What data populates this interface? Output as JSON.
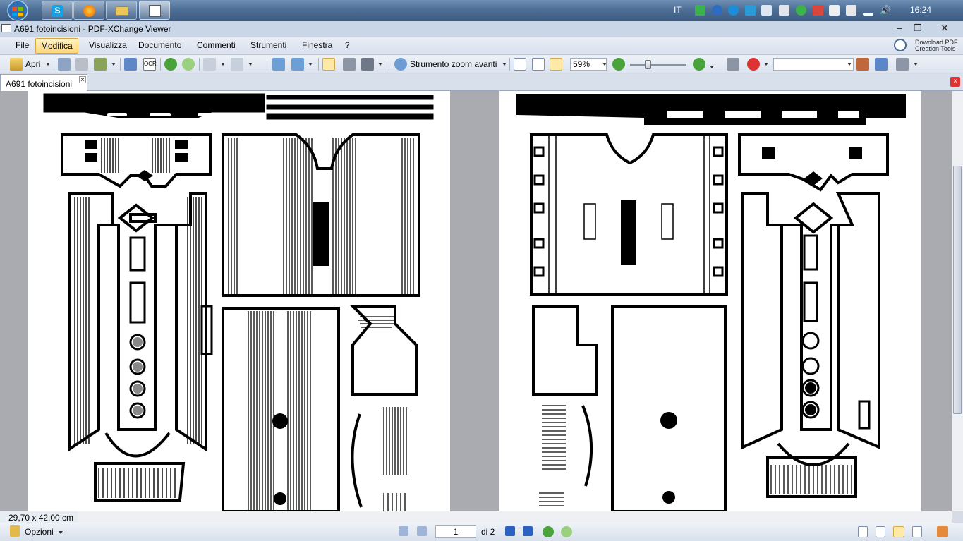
{
  "taskbar": {
    "language": "IT",
    "clock": "16:24",
    "pinned": [
      "skype-icon",
      "firefox-icon",
      "explorer-icon",
      "pdf-viewer-icon"
    ]
  },
  "window": {
    "title": "A691 fotoincisioni - PDF-XChange Viewer"
  },
  "menu": {
    "file": "File",
    "modifica": "Modifica",
    "visualizza": "Visualizza",
    "documento": "Documento",
    "commenti": "Commenti",
    "strumenti": "Strumenti",
    "finestra": "Finestra",
    "help": "?",
    "download_line1": "Download PDF",
    "download_line2": "Creation Tools"
  },
  "toolbar": {
    "open_label": "Apri",
    "zoom_tool_label": "Strumento zoom avanti",
    "zoom_value": "59%",
    "ocr_label": "OCR"
  },
  "tabs": {
    "document_tab": "A691 fotoincisioni",
    "close_symbol": "×"
  },
  "status": {
    "page_size": "29,70 x 42,00 cm",
    "options_label": "Opzioni",
    "current_page": "1",
    "page_count": "di 2"
  },
  "colors": {
    "accent_menu": "#ffd77a",
    "taskbar": "#4e6f96",
    "doc_background": "#a9abb0"
  }
}
